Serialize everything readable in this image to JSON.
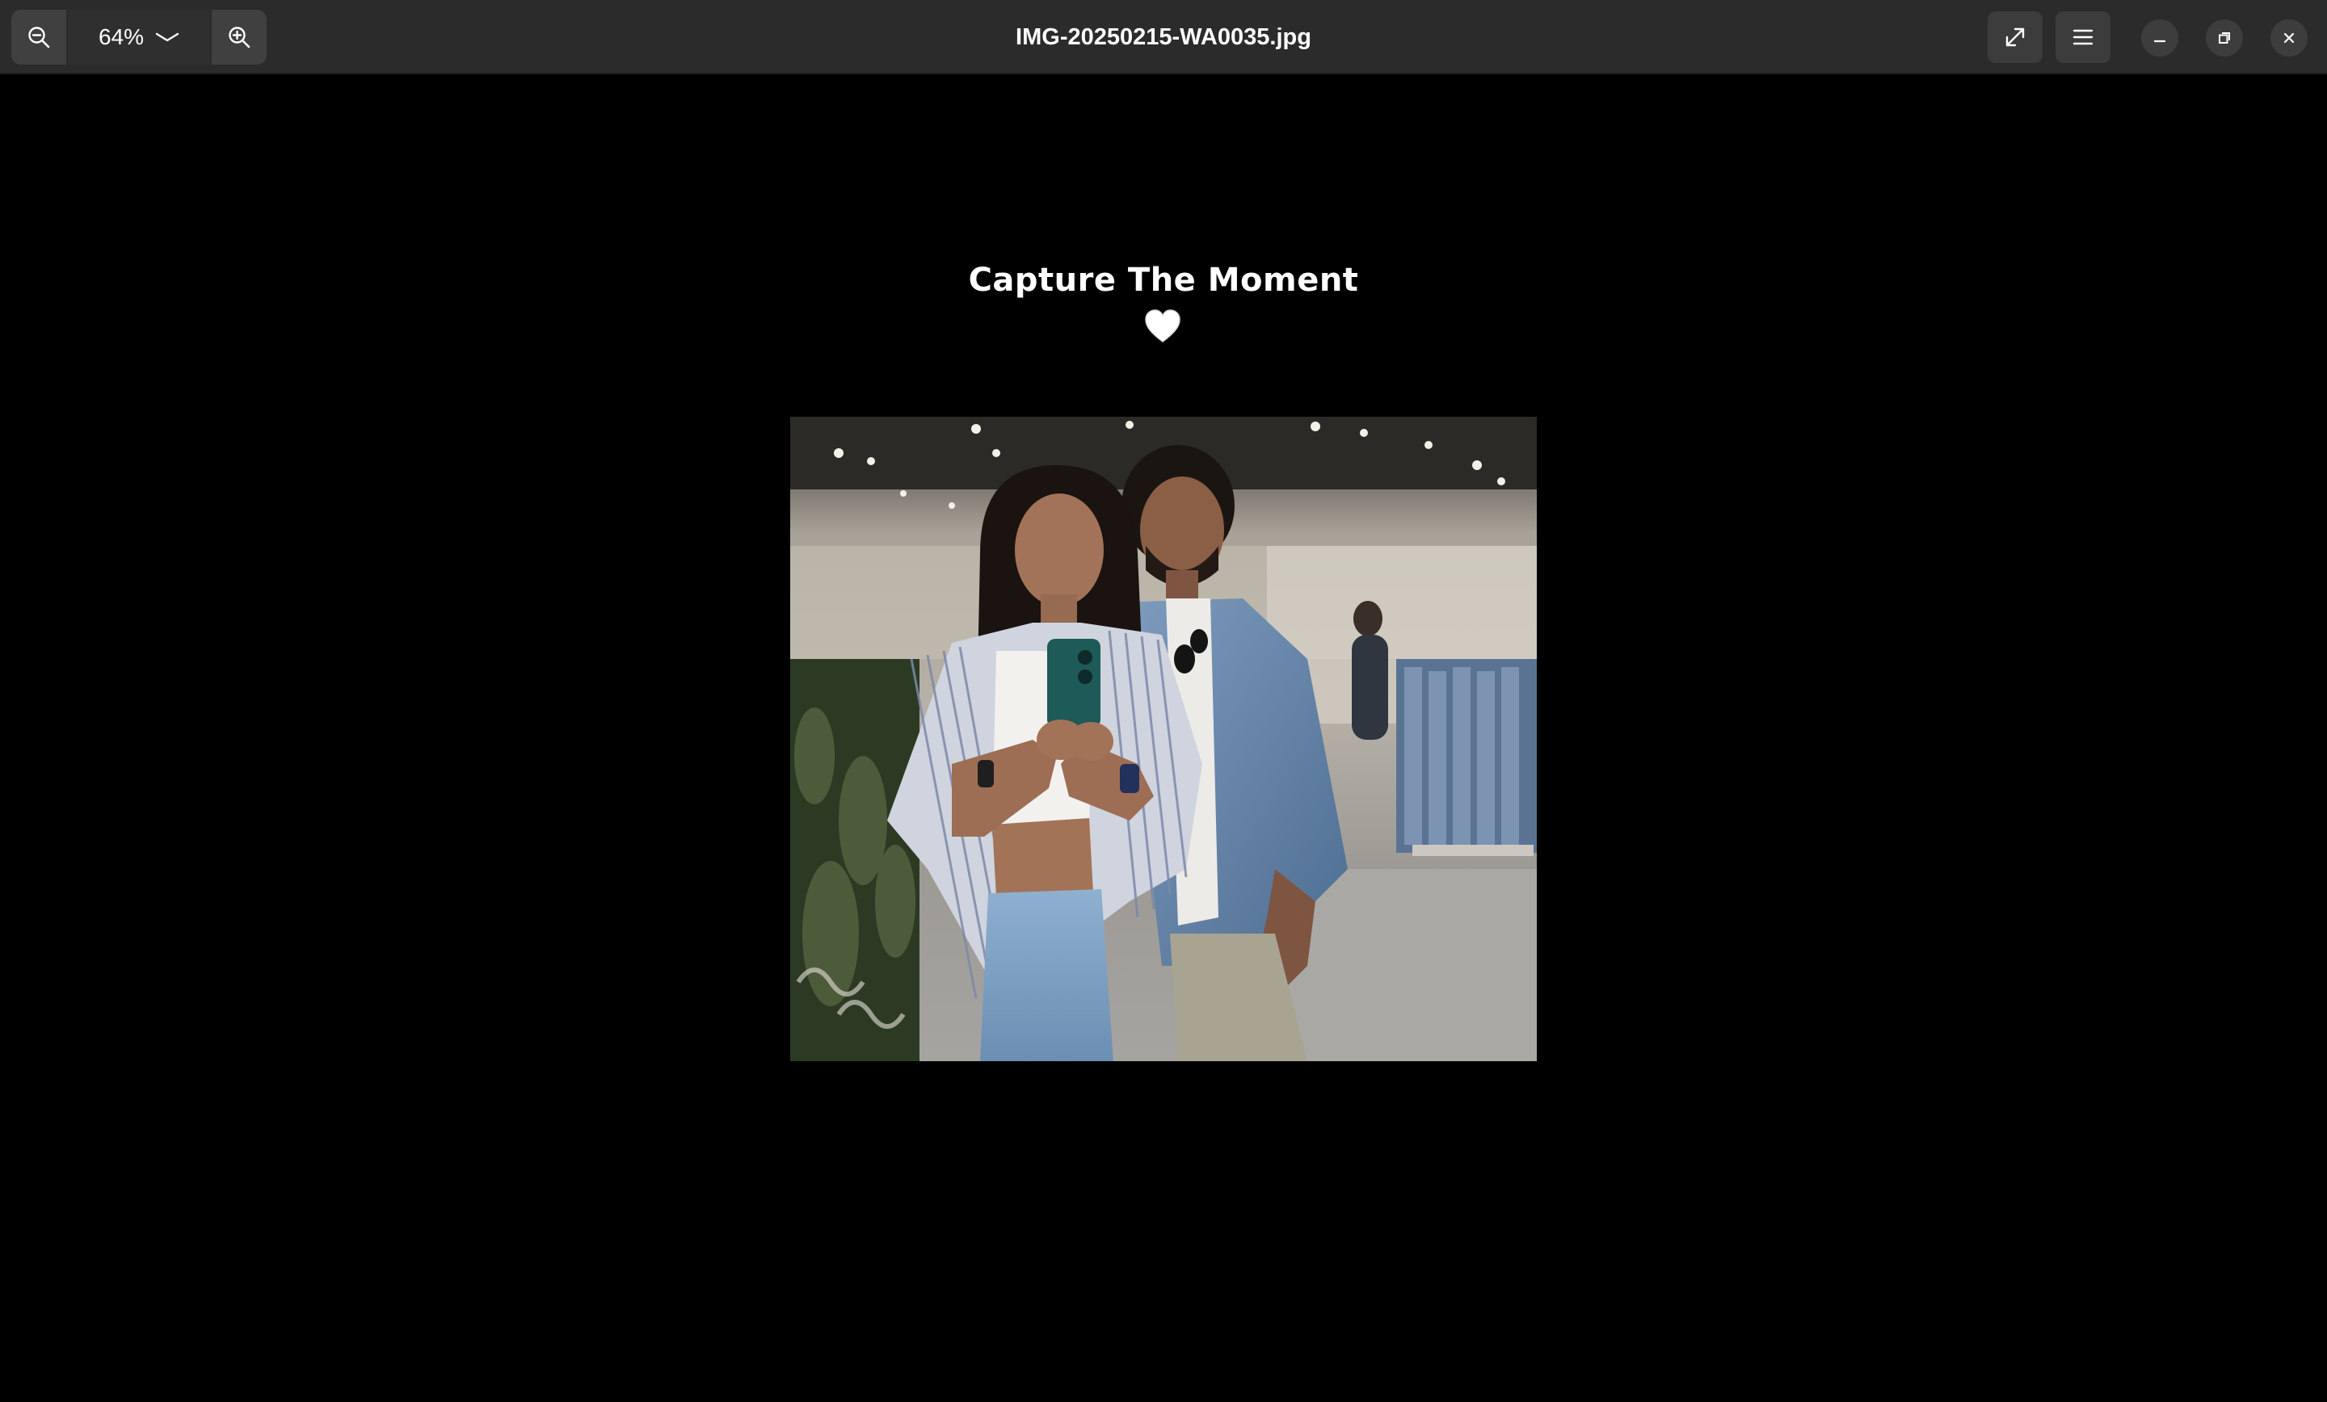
{
  "app": {
    "title": "IMG-20250215-WA0035.jpg"
  },
  "toolbar": {
    "zoom_out_icon": "zoom-out-icon",
    "zoom_level": "64%",
    "zoom_dropdown_icon": "chevron-down-icon",
    "zoom_in_icon": "zoom-in-icon",
    "fullscreen_icon": "fullscreen-icon",
    "menu_icon": "hamburger-menu-icon"
  },
  "window_controls": {
    "minimize_icon": "minimize-icon",
    "maximize_icon": "restore-icon",
    "close_icon": "close-icon"
  },
  "image": {
    "caption": "Capture The Moment",
    "caption_emoji": "🤍",
    "heart_color": "#ffffff",
    "description_icon": "photo-couple-mirror-selfie"
  },
  "colors": {
    "headerbar": "#2b2b2b",
    "background": "#000000",
    "text": "#ffffff"
  }
}
